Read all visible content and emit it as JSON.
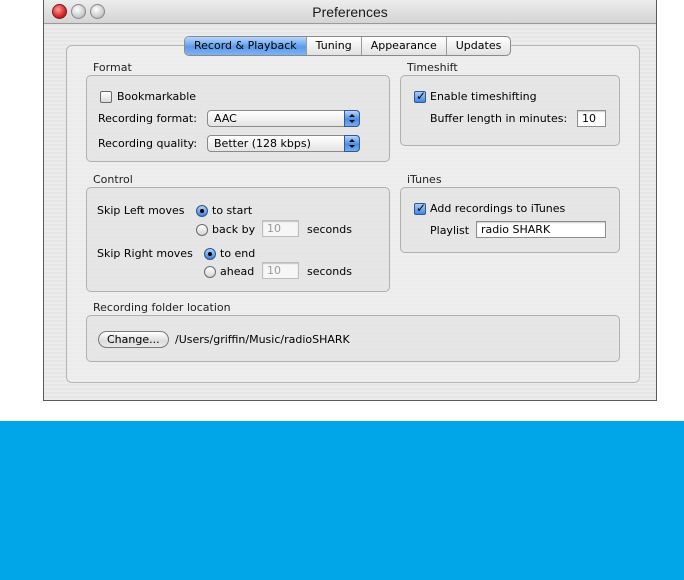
{
  "window": {
    "title": "Preferences"
  },
  "tabs": [
    {
      "label": "Record & Playback",
      "active": true
    },
    {
      "label": "Tuning",
      "active": false
    },
    {
      "label": "Appearance",
      "active": false
    },
    {
      "label": "Updates",
      "active": false
    }
  ],
  "format": {
    "section_label": "Format",
    "bookmarkable_label": "Bookmarkable",
    "bookmarkable_checked": false,
    "recording_format_label": "Recording format:",
    "recording_format_value": "AAC",
    "recording_quality_label": "Recording quality:",
    "recording_quality_value": "Better (128 kbps)"
  },
  "timeshift": {
    "section_label": "Timeshift",
    "enable_label": "Enable timeshifting",
    "enable_checked": true,
    "buffer_label": "Buffer length in minutes:",
    "buffer_value": "10"
  },
  "control": {
    "section_label": "Control",
    "skip_left_label": "Skip Left moves",
    "skip_left_to_start_label": "to start",
    "skip_left_back_by_label": "back by",
    "skip_left_back_by_value": "10",
    "skip_left_seconds_label": "seconds",
    "skip_right_label": "Skip Right moves",
    "skip_right_to_end_label": "to end",
    "skip_right_ahead_label": "ahead",
    "skip_right_ahead_value": "10",
    "skip_right_seconds_label": "seconds"
  },
  "itunes": {
    "section_label": "iTunes",
    "add_label": "Add recordings to iTunes",
    "add_checked": true,
    "playlist_label": "Playlist",
    "playlist_value": "radio SHARK"
  },
  "folder": {
    "section_label": "Recording folder location",
    "change_button": "Change...",
    "path": "/Users/griffin/Music/radioSHARK"
  },
  "colors": {
    "accent": "#5b9bea",
    "background_band": "#00a6e8"
  }
}
